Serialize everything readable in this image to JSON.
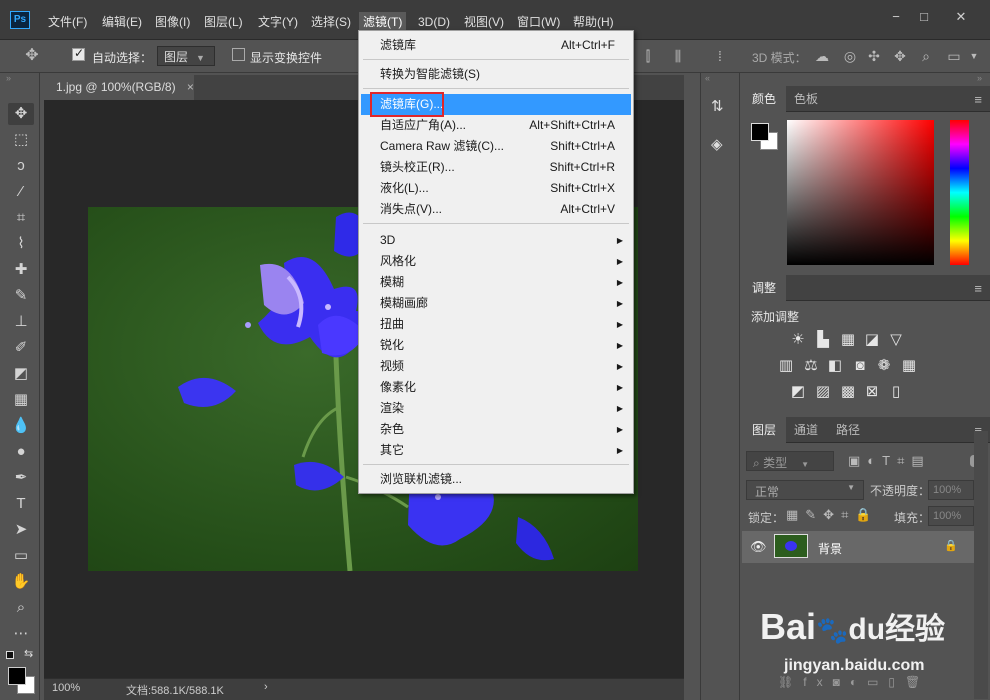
{
  "app": {
    "logo": "Ps"
  },
  "menubar": {
    "items": [
      "文件(F)",
      "编辑(E)",
      "图像(I)",
      "图层(L)",
      "文字(Y)",
      "选择(S)",
      "滤镜(T)",
      "3D(D)",
      "视图(V)",
      "窗口(W)",
      "帮助(H)"
    ],
    "active_index": 6
  },
  "window": {
    "minimize": "−",
    "restore": "□",
    "close": "✕"
  },
  "options_bar": {
    "auto_select_label": "自动选择：",
    "auto_select_value": "图层",
    "show_transform_label": "显示变换控件",
    "mode_3d_label": "3D 模式："
  },
  "document": {
    "tab_title": "1.jpg @ 100%(RGB/8)",
    "tab_close": "×"
  },
  "status": {
    "zoom": "100%",
    "doc_info": "文档:588.1K/588.1K",
    "arrow": "›"
  },
  "filter_menu": {
    "items": [
      {
        "label": "滤镜库",
        "shortcut": "Alt+Ctrl+F"
      },
      {
        "label": "转换为智能滤镜(S)",
        "shortcut": ""
      },
      {
        "label": "滤镜库(G)...",
        "shortcut": ""
      },
      {
        "label": "自适应广角(A)...",
        "shortcut": "Alt+Shift+Ctrl+A"
      },
      {
        "label": "Camera Raw 滤镜(C)...",
        "shortcut": "Shift+Ctrl+A"
      },
      {
        "label": "镜头校正(R)...",
        "shortcut": "Shift+Ctrl+R"
      },
      {
        "label": "液化(L)...",
        "shortcut": "Shift+Ctrl+X"
      },
      {
        "label": "消失点(V)...",
        "shortcut": "Alt+Ctrl+V"
      },
      {
        "label": "3D",
        "shortcut": ""
      },
      {
        "label": "风格化",
        "shortcut": ""
      },
      {
        "label": "模糊",
        "shortcut": ""
      },
      {
        "label": "模糊画廊",
        "shortcut": ""
      },
      {
        "label": "扭曲",
        "shortcut": ""
      },
      {
        "label": "锐化",
        "shortcut": ""
      },
      {
        "label": "视频",
        "shortcut": ""
      },
      {
        "label": "像素化",
        "shortcut": ""
      },
      {
        "label": "渲染",
        "shortcut": ""
      },
      {
        "label": "杂色",
        "shortcut": ""
      },
      {
        "label": "其它",
        "shortcut": ""
      },
      {
        "label": "浏览联机滤镜...",
        "shortcut": ""
      }
    ],
    "highlighted_index": 2,
    "submenu_arrow": "▶"
  },
  "panels": {
    "color": {
      "tabs": [
        "颜色",
        "色板"
      ]
    },
    "adjustments": {
      "tab": "调整",
      "add_label": "添加调整"
    },
    "layers": {
      "tabs": [
        "图层",
        "通道",
        "路径"
      ],
      "filter_kind": "类型",
      "blend_mode": "正常",
      "opacity_label": "不透明度：",
      "opacity_value": "100%",
      "lock_label": "锁定：",
      "fill_label": "填充：",
      "fill_value": "100%",
      "layer_name": "背景"
    }
  },
  "watermark": {
    "brand": "Bai",
    "brand2": "du",
    "cn": "经验",
    "url": "jingyan.baidu.com"
  },
  "colors": {
    "accent": "#3399ff",
    "highlight_box": "#e0262a",
    "canvas_bg": "#282828",
    "panel_bg": "#535353"
  }
}
